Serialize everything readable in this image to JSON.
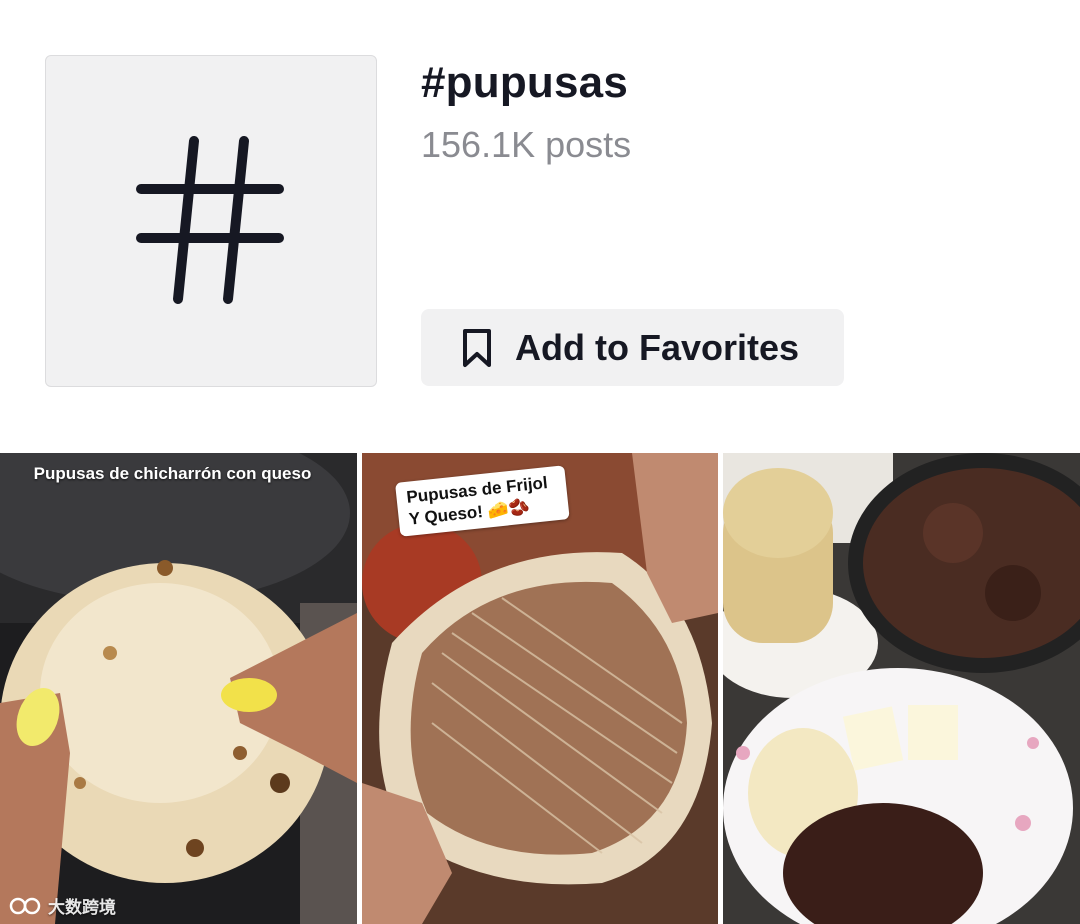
{
  "header": {
    "hashtag_icon": "hashtag-icon",
    "title": "#pupusas",
    "posts_count": "156.1K posts",
    "favorites_button": {
      "icon": "bookmark-icon",
      "label": "Add to Favorites"
    }
  },
  "videos": [
    {
      "caption": "Pupusas de chicharrón con queso"
    },
    {
      "caption": "Pupusas de Frijol Y Queso! 🧀🫘"
    },
    {
      "caption": ""
    }
  ],
  "watermark": {
    "text": "大数跨境"
  },
  "colors": {
    "text_primary": "#161823",
    "text_secondary": "#8a8b91",
    "surface": "#f1f1f2"
  }
}
